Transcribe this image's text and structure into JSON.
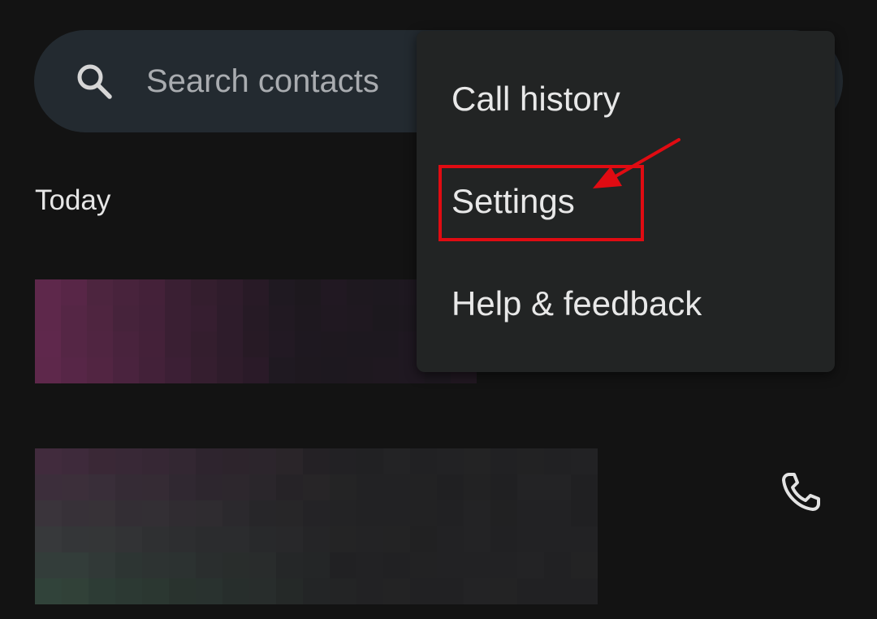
{
  "search": {
    "placeholder": "Search contacts",
    "icon": "search-icon"
  },
  "section": {
    "header": "Today"
  },
  "menu": {
    "items": [
      {
        "label": "Call history"
      },
      {
        "label": "Settings"
      },
      {
        "label": "Help & feedback"
      }
    ]
  },
  "annotation": {
    "color": "#e00b12",
    "highlighted_item": "Settings"
  },
  "contact_rows": {
    "call_icon": "phone-icon"
  },
  "colors": {
    "background": "#131313",
    "search_bar": "#232a30",
    "menu_background": "#222424",
    "annotation": "#e00b12"
  }
}
